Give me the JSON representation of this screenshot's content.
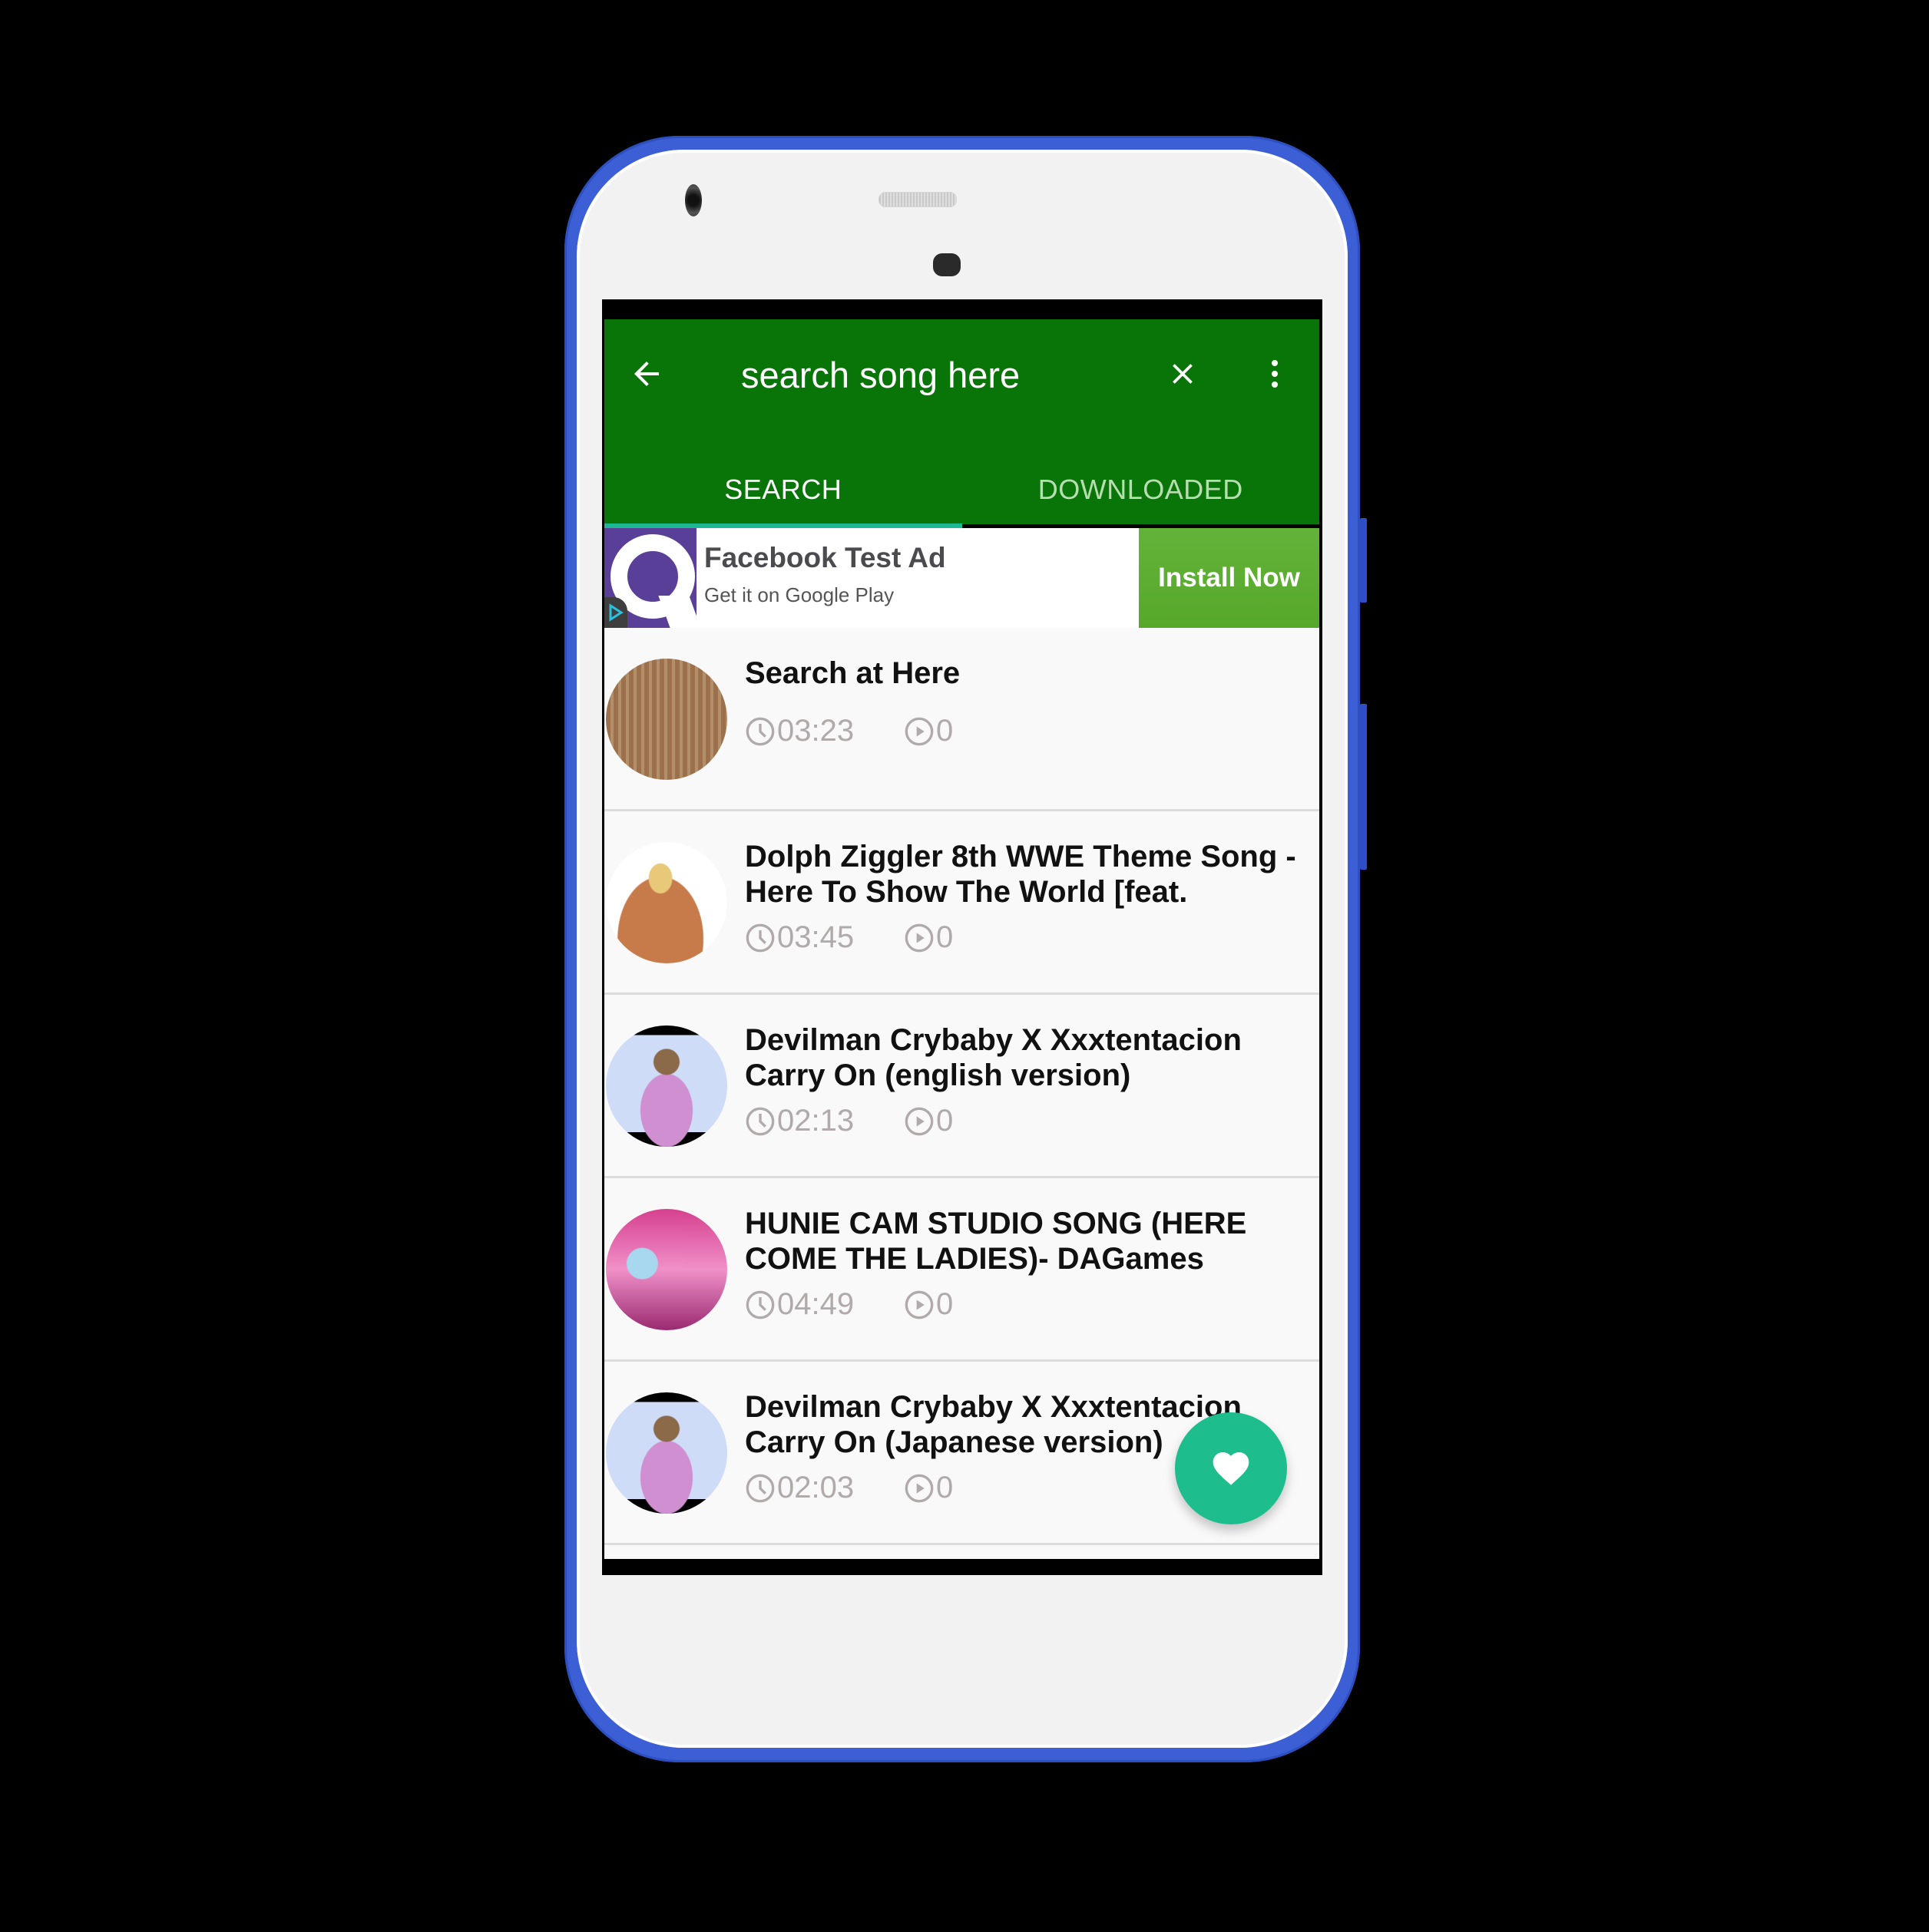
{
  "colors": {
    "app_bar": "#097509",
    "tab_indicator": "#1fb895",
    "install_button": "#5bac2e",
    "fab": "#1dbd8e",
    "phone_frame": "#3c5fd6",
    "meta_text": "#b0aaaa"
  },
  "toolbar": {
    "back_icon": "arrow-left-icon",
    "search_placeholder": "search song here",
    "search_value": "",
    "clear_icon": "close-icon",
    "more_icon": "more-vert-icon"
  },
  "tabs": [
    {
      "label": "SEARCH",
      "active": true
    },
    {
      "label": "DOWNLOADED",
      "active": false
    }
  ],
  "ad": {
    "title": "Facebook Test Ad",
    "subtitle": "Get it on Google Play",
    "cta": "Install Now",
    "icon": "q-logo-icon",
    "adchoices_icon": "adchoices-icon"
  },
  "songs": [
    {
      "title": "Search at Here",
      "duration": "03:23",
      "plays": "0"
    },
    {
      "title": "Dolph Ziggler 8th WWE Theme Song -  Here To Show The World [feat.",
      "duration": "03:45",
      "plays": "0"
    },
    {
      "title": "Devilman Crybaby X  Xxxtentacion Carry On (english version)",
      "duration": "02:13",
      "plays": "0"
    },
    {
      "title": "HUNIE CAM STUDIO SONG (HERE COME THE LADIES)- DAGames",
      "duration": "04:49",
      "plays": "0"
    },
    {
      "title": "Devilman Crybaby X Xxxtentacion Carry On (Japanese version)",
      "duration": "02:03",
      "plays": "0"
    }
  ],
  "fab": {
    "icon": "heart-icon"
  }
}
